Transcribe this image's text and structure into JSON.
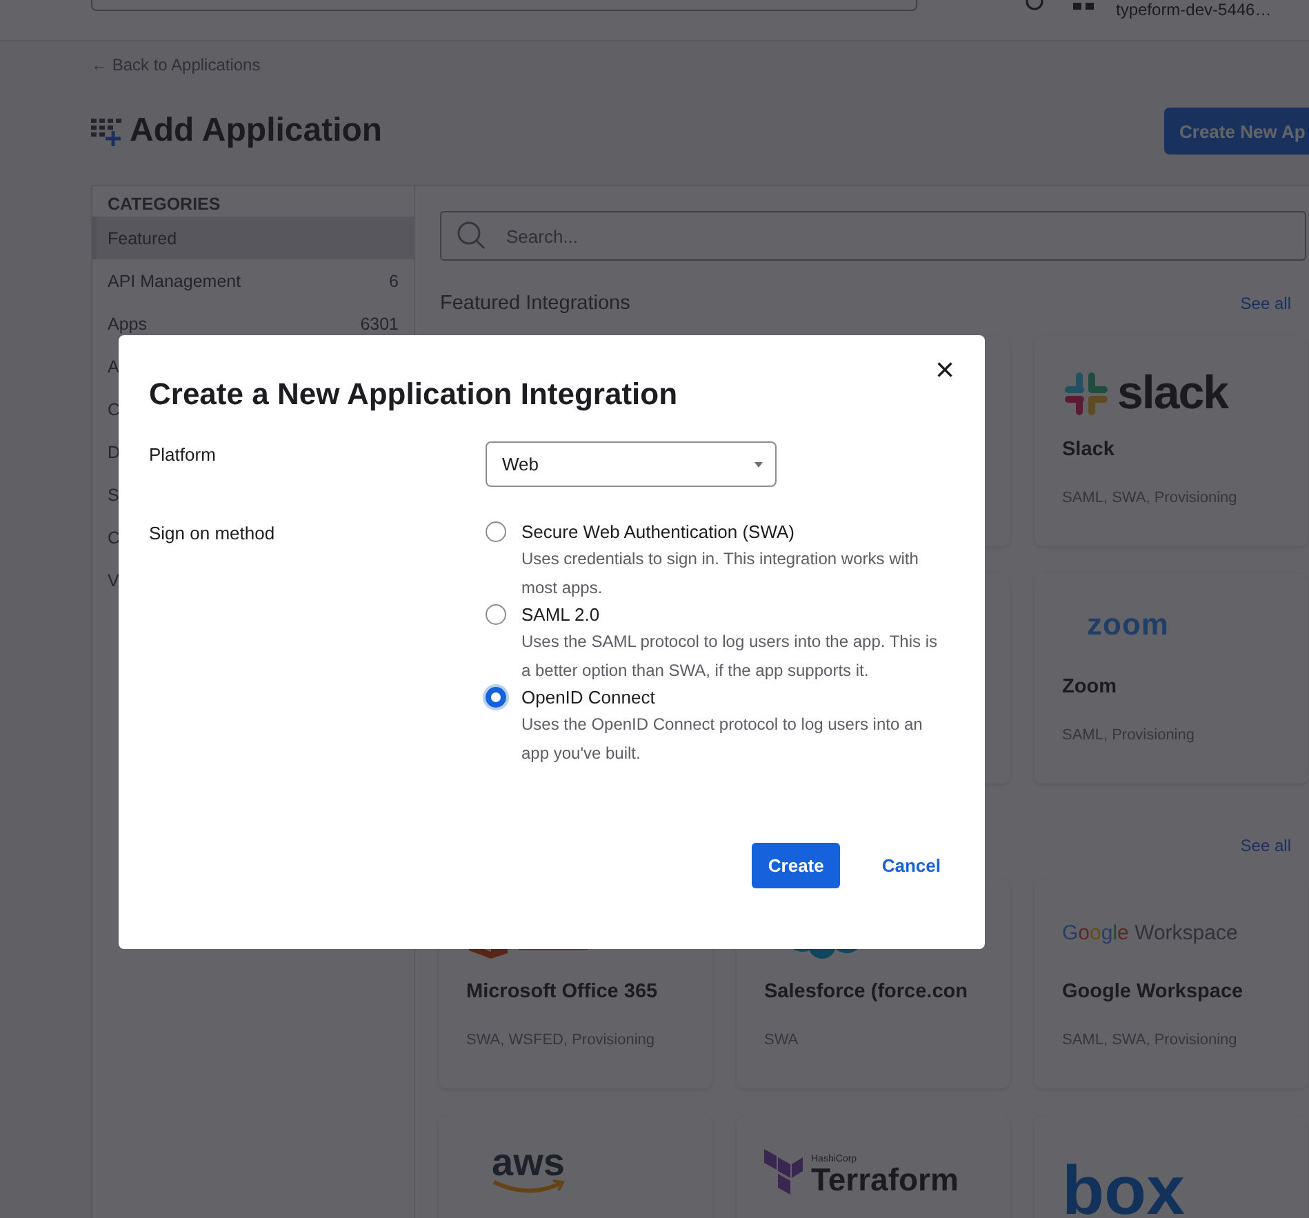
{
  "header": {
    "account": "typeform-dev-5446…"
  },
  "back_link": "← Back to Applications",
  "title": "Add Application",
  "create_button": "Create New Ap",
  "categories": {
    "heading": "CATEGORIES",
    "items": [
      {
        "label": "Featured",
        "selected": true
      },
      {
        "label": "API Management",
        "count": "6",
        "selected": false
      },
      {
        "label": "Apps",
        "count": "6301",
        "selected": false
      },
      {
        "label": "A",
        "selected": false
      },
      {
        "label": "C",
        "selected": false
      },
      {
        "label": "D",
        "selected": false
      },
      {
        "label": "S",
        "selected": false
      },
      {
        "label": "C",
        "selected": false
      },
      {
        "label": "V",
        "selected": false
      }
    ]
  },
  "search": {
    "placeholder": "Search..."
  },
  "sections": [
    {
      "title": "Featured Integrations",
      "see_all": "See all",
      "cards": [
        {
          "logo": {
            "kind": "slack",
            "text": "slack"
          },
          "name": "Slack",
          "protocols": "SAML, SWA, Provisioning"
        },
        {
          "logo": {
            "kind": "zoom",
            "text": "zoom"
          },
          "name": "Zoom",
          "protocols": "SAML, Provisioning"
        }
      ]
    },
    {
      "see_all": "See all",
      "cards": [
        {
          "logo": {
            "kind": "office"
          },
          "name": "Microsoft Office 365",
          "protocols": "SWA, WSFED, Provisioning"
        },
        {
          "logo": {
            "kind": "salesforce"
          },
          "name": "Salesforce (force.con",
          "protocols": "SWA"
        },
        {
          "logo": {
            "kind": "google",
            "text": "Google",
            "text2": "Workspace"
          },
          "name": "Google Workspace",
          "protocols": "SAML, SWA, Provisioning"
        },
        {
          "logo": {
            "kind": "aws",
            "text": "aws"
          }
        },
        {
          "logo": {
            "kind": "terraform",
            "text": "Terraform",
            "text2": "HashiCorp"
          }
        },
        {
          "logo": {
            "kind": "box",
            "text": "box"
          }
        }
      ]
    }
  ],
  "dialog": {
    "title": "Create a New Application Integration",
    "close": "×",
    "fields": [
      {
        "kind": "select",
        "label": "Platform",
        "value": "Web"
      },
      {
        "kind": "radio",
        "label": "Sign on method",
        "options": [
          {
            "label": "Secure Web Authentication (SWA)",
            "description": "Uses credentials to sign in. This integration works with most apps.",
            "selected": false
          },
          {
            "label": "SAML 2.0",
            "description": "Uses the SAML protocol to log users into the app. This is a better option than SWA, if the app supports it.",
            "selected": false
          },
          {
            "label": "OpenID Connect",
            "description": "Uses the OpenID Connect protocol to log users into an app you've built.",
            "selected": true
          }
        ]
      }
    ],
    "buttons": [
      {
        "kind": "primary",
        "label": "Create"
      },
      {
        "kind": "link",
        "label": "Cancel"
      }
    ]
  }
}
